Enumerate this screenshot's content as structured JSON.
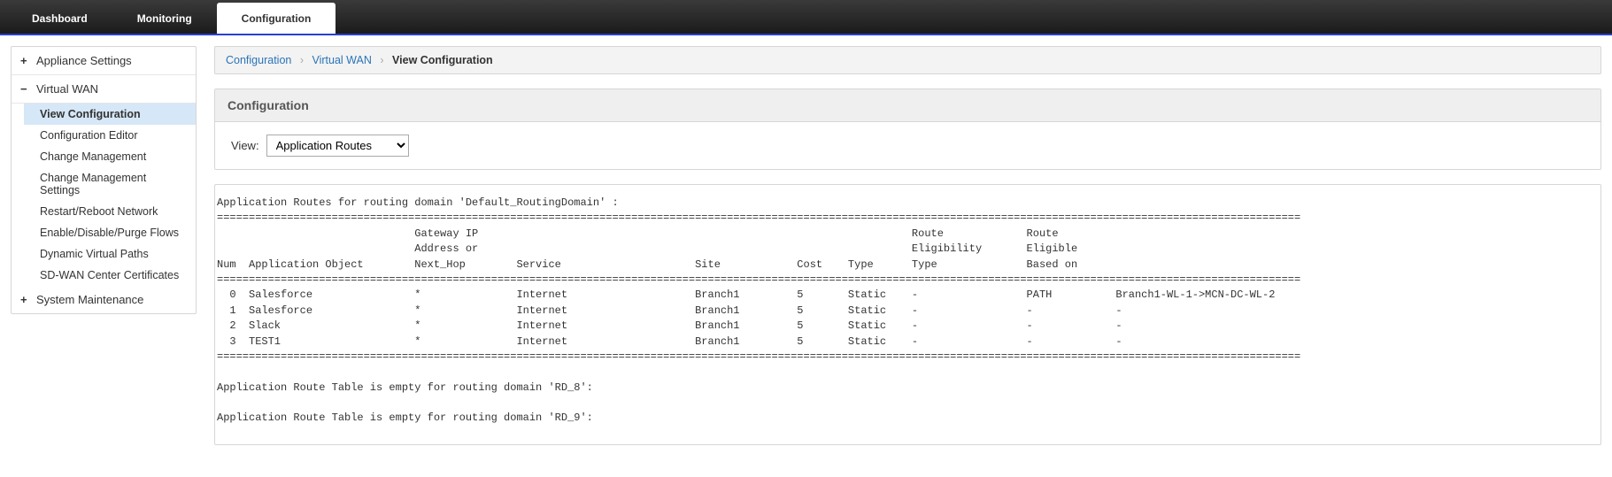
{
  "topnav": {
    "tabs": [
      "Dashboard",
      "Monitoring",
      "Configuration"
    ],
    "active_index": 2
  },
  "sidebar": {
    "groups": [
      {
        "label": "Appliance Settings",
        "expanded": false,
        "items": []
      },
      {
        "label": "Virtual WAN",
        "expanded": true,
        "items": [
          "View Configuration",
          "Configuration Editor",
          "Change Management",
          "Change Management Settings",
          "Restart/Reboot Network",
          "Enable/Disable/Purge Flows",
          "Dynamic Virtual Paths",
          "SD-WAN Center Certificates"
        ],
        "selected_index": 0
      },
      {
        "label": "System Maintenance",
        "expanded": false,
        "items": []
      }
    ]
  },
  "breadcrumb": {
    "parts": [
      "Configuration",
      "Virtual WAN",
      "View Configuration"
    ]
  },
  "panel": {
    "title": "Configuration",
    "view_label": "View:",
    "view_selected": "Application Routes"
  },
  "output": {
    "title_line": "Application Routes for routing domain 'Default_RoutingDomain' :",
    "columns": [
      "Num",
      "Application Object",
      "Gateway IP Address or Next_Hop",
      "Service",
      "Site",
      "Cost",
      "Type",
      "Route Eligibility Type",
      "Route Eligible Based on"
    ],
    "rows": [
      {
        "num": 0,
        "app": "Salesforce",
        "gw": "*",
        "service": "Internet",
        "site": "Branch1",
        "cost": 5,
        "type": "Static",
        "elig_type": "-",
        "elig_based": "PATH",
        "extra": "Branch1-WL-1->MCN-DC-WL-2"
      },
      {
        "num": 1,
        "app": "Salesforce",
        "gw": "*",
        "service": "Internet",
        "site": "Branch1",
        "cost": 5,
        "type": "Static",
        "elig_type": "-",
        "elig_based": "-",
        "extra": "-"
      },
      {
        "num": 2,
        "app": "Slack",
        "gw": "*",
        "service": "Internet",
        "site": "Branch1",
        "cost": 5,
        "type": "Static",
        "elig_type": "-",
        "elig_based": "-",
        "extra": "-"
      },
      {
        "num": 3,
        "app": "TEST1",
        "gw": "*",
        "service": "Internet",
        "site": "Branch1",
        "cost": 5,
        "type": "Static",
        "elig_type": "-",
        "elig_based": "-",
        "extra": "-"
      }
    ],
    "footer_lines": [
      "Application Route Table is empty for routing domain 'RD_8':",
      "Application Route Table is empty for routing domain 'RD_9':"
    ]
  }
}
